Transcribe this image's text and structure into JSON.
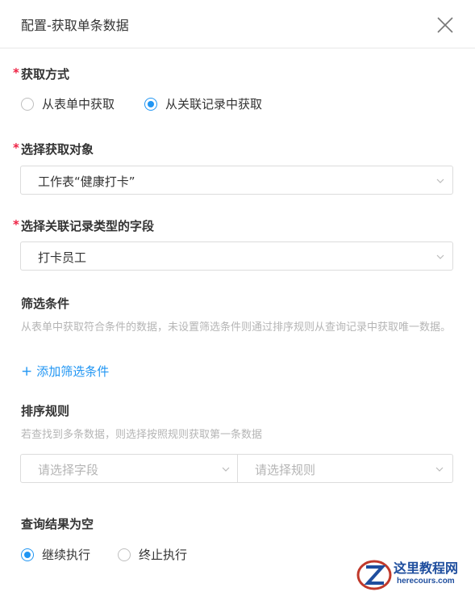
{
  "header": {
    "title": "配置-获取单条数据"
  },
  "method": {
    "label": "获取方式",
    "required": "*",
    "options": [
      "从表单中获取",
      "从关联记录中获取"
    ],
    "selected": 1
  },
  "target": {
    "label": "选择获取对象",
    "required": "*",
    "value": "工作表“健康打卡”"
  },
  "relation_field": {
    "label": "选择关联记录类型的字段",
    "required": "*",
    "value": "打卡员工"
  },
  "filter": {
    "label": "筛选条件",
    "hint": "从表单中获取符合条件的数据，未设置筛选条件则通过排序规则从查询记录中获取唯一数据。",
    "add_label": "添加筛选条件"
  },
  "sort": {
    "label": "排序规则",
    "hint": "若查找到多条数据，则选择按照规则获取第一条数据",
    "field_placeholder": "请选择字段",
    "rule_placeholder": "请选择规则"
  },
  "empty_result": {
    "label": "查询结果为空",
    "options": [
      "继续执行",
      "终止执行"
    ],
    "selected": 0
  },
  "watermark": {
    "line1": "这里教程网",
    "line2": "herecours.com"
  },
  "colors": {
    "accent": "#2196f3",
    "required": "#e24444",
    "placeholder": "#b5b5b5",
    "border": "#dcdcdc"
  }
}
